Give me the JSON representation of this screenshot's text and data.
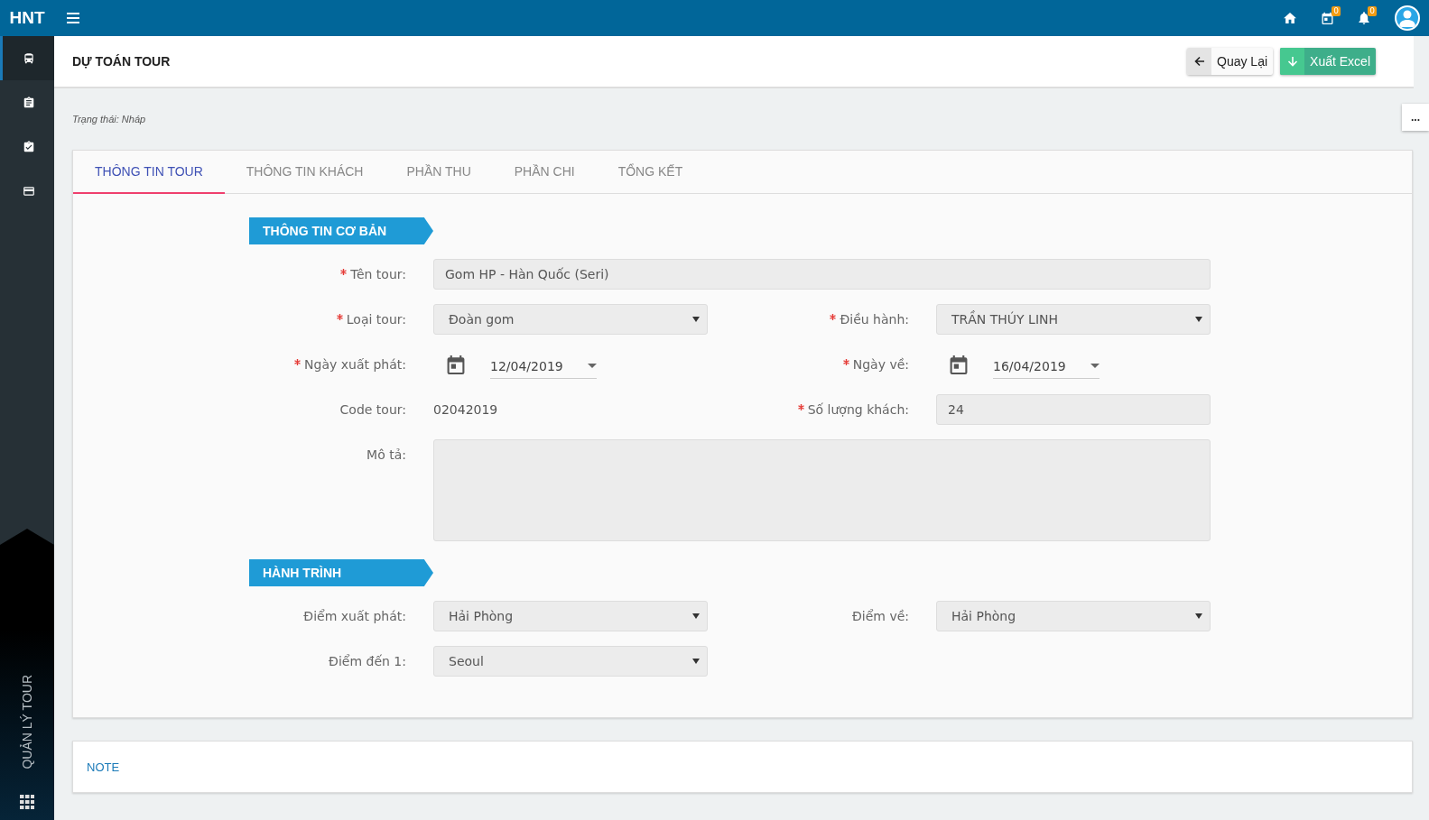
{
  "topbar": {
    "brand": "HNT",
    "calendar_badge": "0",
    "bell_badge": "0"
  },
  "sidebar": {
    "items": [
      {
        "selected": true
      },
      {
        "selected": false
      },
      {
        "selected": false
      },
      {
        "selected": false
      }
    ],
    "module_label": "QUẢN LÝ TOUR"
  },
  "header": {
    "title": "DỰ TOÁN TOUR",
    "buttons": [
      {
        "kind": "back",
        "label": "Quay Lại"
      },
      {
        "kind": "export",
        "label": "Xuất Excel"
      }
    ]
  },
  "status": "Trạng thái: Nháp",
  "more_button": "...",
  "tabs": [
    {
      "label": "THÔNG TIN TOUR",
      "selected": true
    },
    {
      "label": "THÔNG TIN KHÁCH",
      "selected": false
    },
    {
      "label": "PHẦN THU",
      "selected": false
    },
    {
      "label": "PHẦN CHI",
      "selected": false
    },
    {
      "label": "TỔNG KẾT",
      "selected": false
    }
  ],
  "sections": [
    {
      "title": "THÔNG TIN CƠ BẢN",
      "rows": [
        [
          {
            "label": "Tên tour:",
            "required": true,
            "kind": "text",
            "value": "Gom HP - Hàn Quốc (Seri)"
          }
        ],
        [
          {
            "label": "Loại tour:",
            "required": true,
            "kind": "select",
            "value": "Đoàn gom"
          },
          {
            "label": "Điều hành:",
            "required": true,
            "kind": "select",
            "value": "TRẦN THÚY LINH"
          }
        ],
        [
          {
            "label": "Ngày xuất phát:",
            "required": true,
            "kind": "date",
            "value": "12/04/2019"
          },
          {
            "label": "Ngày về:",
            "required": true,
            "kind": "date",
            "value": "16/04/2019"
          }
        ],
        [
          {
            "label": "Code tour:",
            "required": false,
            "kind": "static",
            "value": "02042019"
          },
          {
            "label": "Số lượng khách:",
            "required": true,
            "kind": "input",
            "value": "24"
          }
        ],
        [
          {
            "label": "Mô tả:",
            "required": false,
            "kind": "textarea"
          }
        ]
      ]
    },
    {
      "title": "HÀNH TRÌNH",
      "rows": [
        [
          {
            "label": "Điểm xuất phát:",
            "required": false,
            "kind": "select",
            "value": "Hải Phòng"
          },
          {
            "label": "Điểm về:",
            "required": false,
            "kind": "select",
            "value": "Hải Phòng"
          }
        ],
        [
          {
            "label": "Điểm đến 1:",
            "required": false,
            "kind": "select",
            "value": "Seoul"
          }
        ]
      ]
    }
  ],
  "note": {
    "title": "NOTE"
  }
}
